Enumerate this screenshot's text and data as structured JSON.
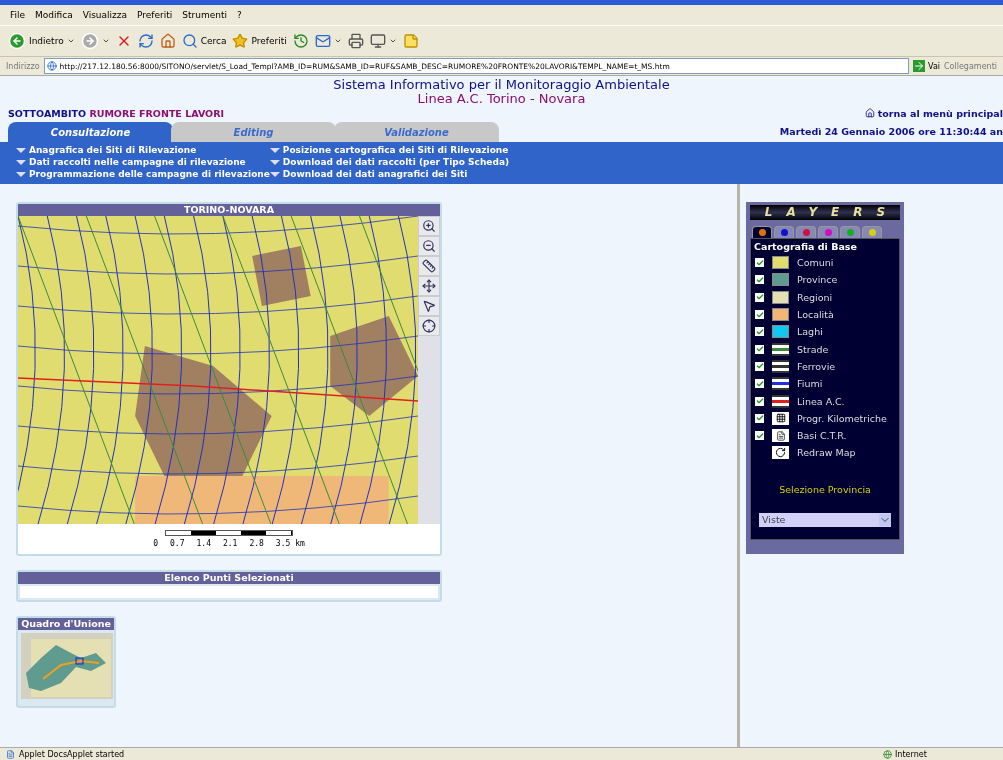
{
  "browser": {
    "menu": [
      "File",
      "Modifica",
      "Visualizza",
      "Preferiti",
      "Strumenti",
      "?"
    ],
    "toolbar": [
      {
        "kind": "back",
        "label": "Indietro",
        "has_menu": true
      },
      {
        "kind": "forward",
        "has_menu": true
      },
      {
        "kind": "stop",
        "has_menu": false
      },
      {
        "kind": "refresh",
        "has_menu": false
      },
      {
        "kind": "home",
        "has_menu": false
      },
      {
        "kind": "search",
        "label": "Cerca",
        "has_menu": false
      },
      {
        "kind": "favorites",
        "label": "Preferiti",
        "has_menu": false
      },
      {
        "kind": "history",
        "has_menu": false
      },
      {
        "kind": "mail",
        "has_menu": true
      },
      {
        "kind": "print",
        "has_menu": false
      },
      {
        "kind": "edit",
        "has_menu": true
      },
      {
        "kind": "notes",
        "has_menu": false
      }
    ],
    "address": {
      "label": "Indirizzo",
      "value": "http://217.12.180.56:8000/SITONO/servlet/S_Load_Templ?AMB_ID=RUM&SAMB_ID=RUF&SAMB_DESC=RUMORE%20FRONTE%20LAVORI&TEMPL_NAME=t_MS.htm",
      "go": "Vai",
      "links": "Collegamenti"
    }
  },
  "header": {
    "title": "Sistema Informativo per il Monitoraggio Ambientale",
    "subtitle": "Linea A.C. Torino - Novara",
    "scope_label": "SOTTOAMBITO",
    "scope_value": "RUMORE FRONTE LAVORI",
    "home_link": "torna al menù principal",
    "datetime": "Martedì 24 Gennaio 2006 ore 11:30:44 an"
  },
  "tabs": [
    {
      "label": "Consultazione",
      "selected": true
    },
    {
      "label": "Editing",
      "selected": false
    },
    {
      "label": "Validazione",
      "selected": false
    }
  ],
  "menu_links": [
    [
      "Anagrafica dei Siti di Rilevazione",
      "Dati raccolti nelle campagne di rilevazione",
      "Programmazione delle campagne di rilevazione"
    ],
    [
      "Posizione cartografica dei Siti di Rilevazione",
      "Download dei dati raccolti (per Tipo Scheda)",
      "Download dei dati anagrafici dei Siti"
    ]
  ],
  "map": {
    "title": "TORINO-NOVARA",
    "tools": [
      {
        "kind": "zoom-in"
      },
      {
        "kind": "zoom-out"
      },
      {
        "kind": "measure"
      },
      {
        "kind": "pan"
      },
      {
        "kind": "info"
      },
      {
        "kind": "xy"
      }
    ],
    "scale": [
      "0",
      "0.7",
      "1.4",
      "2.1",
      "2.8",
      "3.5 km"
    ]
  },
  "points_panel": {
    "title": "Elenco Punti Selezionati"
  },
  "overview": {
    "title": "Quadro d'Unione"
  },
  "layers": {
    "title": "LAYERS",
    "tabs": [
      {
        "color": "#e07010",
        "selected": true
      },
      {
        "color": "#1010d0",
        "selected": false
      },
      {
        "color": "#d01040",
        "selected": false
      },
      {
        "color": "#d010c0",
        "selected": false
      },
      {
        "color": "#10b020",
        "selected": false
      },
      {
        "color": "#d8d010",
        "selected": false
      }
    ],
    "group": "Cartografia di Base",
    "items": [
      {
        "kind": "fill",
        "label": "Comuni",
        "checked": true,
        "color": "#e0dc70"
      },
      {
        "kind": "fill",
        "label": "Province",
        "checked": true,
        "color": "#5f9b8e"
      },
      {
        "kind": "fill",
        "label": "Regioni",
        "checked": true,
        "color": "#e4e0b4"
      },
      {
        "kind": "fill",
        "label": "Località",
        "checked": true,
        "color": "#f0b878"
      },
      {
        "kind": "fill",
        "label": "Laghi",
        "checked": true,
        "color": "#10c8f0"
      },
      {
        "kind": "line",
        "label": "Strade",
        "checked": true,
        "color": "#3a8a3a"
      },
      {
        "kind": "line",
        "label": "Ferrovie",
        "checked": true,
        "color": "#333333"
      },
      {
        "kind": "line",
        "label": "Fiumi",
        "checked": true,
        "color": "#2030e0"
      },
      {
        "kind": "line",
        "label": "Linea A.C.",
        "checked": true,
        "color": "#e02020"
      },
      {
        "kind": "km",
        "label": "Progr. Kilometriche",
        "checked": true
      },
      {
        "kind": "ctr",
        "label": "Basi C.T.R.",
        "checked": true
      },
      {
        "kind": "redraw",
        "label": "Redraw Map"
      }
    ],
    "province_label": "Selezione Provincia",
    "select": "Viste"
  },
  "status": {
    "text": "Applet DocsApplet started",
    "zone": "Internet"
  }
}
